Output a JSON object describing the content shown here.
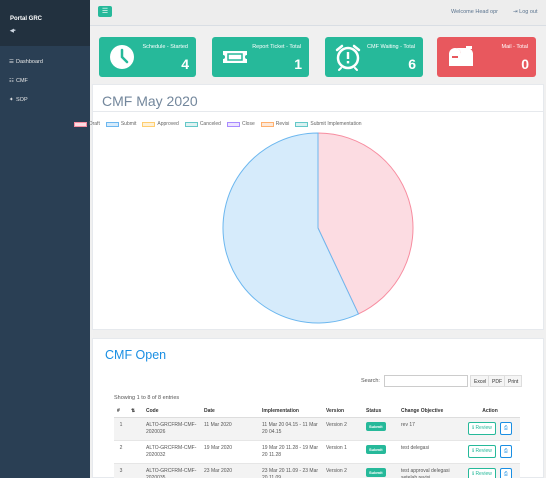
{
  "sidebar": {
    "brand": "Portal GRC",
    "brand_sub": "◀•",
    "items": [
      {
        "icon": "dashboard-icon",
        "glyph": "☰",
        "label": "Dashboard"
      },
      {
        "icon": "document-icon",
        "glyph": "☷",
        "label": "CMF"
      },
      {
        "icon": "sitemap-icon",
        "glyph": "✦",
        "label": "SOP"
      }
    ]
  },
  "topbar": {
    "menu_glyph": "☰",
    "welcome": "Welcome Head opr",
    "logout": "Log out",
    "logout_glyph": "⇥"
  },
  "tiles": [
    {
      "label": "Schedule - Started",
      "value": "4",
      "icon": "clock-icon",
      "color": "#26b99a"
    },
    {
      "label": "Report Ticket - Total",
      "value": "1",
      "icon": "ticket-icon",
      "color": "#26b99a"
    },
    {
      "label": "CMF Waiting - Total",
      "value": "6",
      "icon": "alarm-icon",
      "color": "#26b99a"
    },
    {
      "label": "Mail - Total",
      "value": "0",
      "icon": "mailbox-icon",
      "color": "#e74c5c"
    }
  ],
  "chart_data": {
    "type": "pie",
    "title": "CMF May 2020",
    "labels": [
      "Draft",
      "Submit",
      "Approved",
      "Canceled",
      "Close",
      "Revisi",
      "Submit Implementation"
    ],
    "values": [
      43,
      57,
      0,
      0,
      0,
      0,
      0
    ],
    "colors": [
      "#fcdce2",
      "#d6ebfb",
      "#fff1d6",
      "#dff2f2",
      "#ece4ff",
      "#fde8d8",
      "#d9f1f1"
    ],
    "borders": [
      "#f78da0",
      "#6cb7ef",
      "#ffce6f",
      "#64c8c8",
      "#a98bff",
      "#ffb06e",
      "#64c8c8"
    ],
    "legend_position": "top"
  },
  "cmf_open": {
    "title": "CMF Open",
    "search_label": "Search:",
    "buttons": [
      "Excel",
      "PDF",
      "Print"
    ],
    "showing": "Showing 1 to 8 of 8 entries",
    "columns": [
      "#",
      "",
      "Code",
      "Date",
      "Implementation",
      "Version",
      "Status",
      "Change Objective",
      "Action"
    ],
    "review_label": "Review",
    "review_glyph": "ℹ",
    "print_glyph": "⎙",
    "rows": [
      {
        "num": "1",
        "code": "ALTO-GRCFRM-CMF-2020026",
        "date": "11 Mar 2020",
        "impl": "11 Mar 20 04.15 - 11 Mar 20 04.15",
        "version": "Version 2",
        "status": "Submit",
        "objective": "rev 17"
      },
      {
        "num": "2",
        "code": "ALTO-GRCFRM-CMF-2020032",
        "date": "19 Mar 2020",
        "impl": "19 Mar 20 11.28 - 19 Mar 20 11.28",
        "version": "Version 1",
        "status": "Submit",
        "objective": "test delegasi"
      },
      {
        "num": "3",
        "code": "ALTO-GRCFRM-CMF-2020035",
        "date": "23 Mar 2020",
        "impl": "23 Mar 20 11.09 - 23 Mar 20 11.09",
        "version": "Version 2",
        "status": "Submit",
        "objective": "test approval delegasi setelah revisi"
      }
    ]
  }
}
